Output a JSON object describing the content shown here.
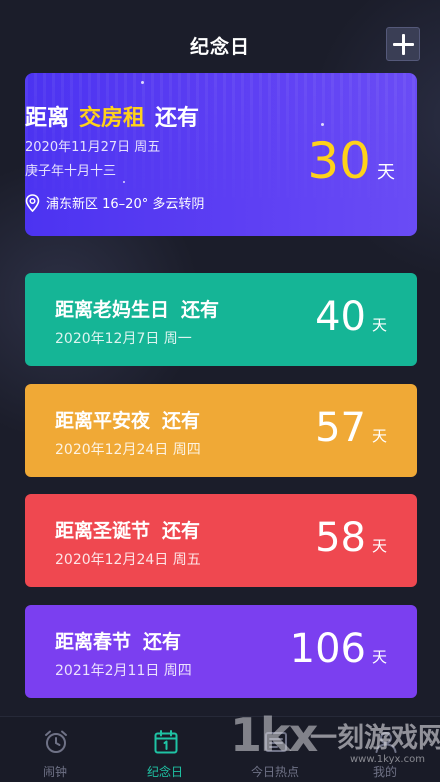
{
  "header": {
    "title": "纪念日"
  },
  "hero": {
    "prefix": "距离",
    "event": "交房租",
    "suffix": "还有",
    "date": "2020年11月27日   周五",
    "lunar": "庚子年十月十三",
    "weather": "浦东新区   16–20°  多云转阴",
    "days": "30",
    "unit": "天",
    "accent_color": "#ffd21a",
    "icon": "location-pin-icon"
  },
  "events": [
    {
      "title": "距离老妈生日",
      "suffix": "还有",
      "date": "2020年12月7日  周一",
      "days": "40",
      "unit": "天",
      "color": "#15b596"
    },
    {
      "title": "距离平安夜",
      "suffix": "还有",
      "date": "2020年12月24日  周四",
      "days": "57",
      "unit": "天",
      "color": "#f0a936"
    },
    {
      "title": "距离圣诞节",
      "suffix": "还有",
      "date": "2020年12月24日  周五",
      "days": "58",
      "unit": "天",
      "color": "#ef4850"
    },
    {
      "title": "距离春节",
      "suffix": "还有",
      "date": "2021年2月11日  周四",
      "days": "106",
      "unit": "天",
      "color": "#7b3ff0"
    }
  ],
  "tabs": [
    {
      "label": "闹钟",
      "icon": "alarm-clock-icon",
      "active": false
    },
    {
      "label": "纪念日",
      "icon": "calendar-icon",
      "active": true
    },
    {
      "label": "今日热点",
      "icon": "hot-news-icon",
      "active": false
    },
    {
      "label": "我的",
      "icon": "user-icon",
      "active": false
    }
  ],
  "watermark": {
    "logo": "1kx",
    "text": "一刻游戏网",
    "url": "www.1kyx.com"
  },
  "colors": {
    "background": "#1b1d2a",
    "tab_active": "#1fc3a4",
    "tab_inactive": "#6f7286"
  }
}
